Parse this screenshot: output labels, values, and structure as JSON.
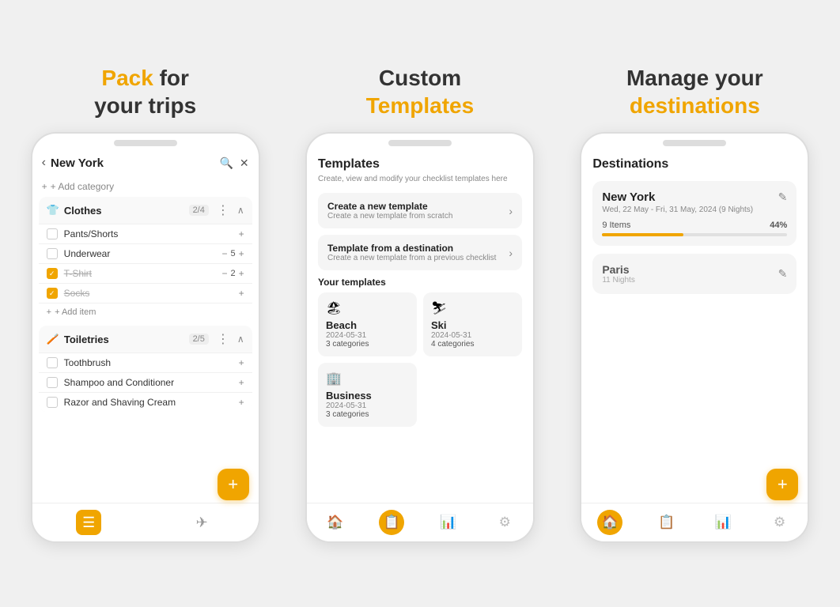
{
  "col1": {
    "headline_part1": "Pack ",
    "headline_part2": "for",
    "headline_part3": "your trips",
    "phone": {
      "title": "New York",
      "add_category": "+ Add category",
      "clothes": {
        "name": "Clothes",
        "count": "2/4",
        "items": [
          {
            "label": "Pants/Shorts",
            "checked": false,
            "qty": null
          },
          {
            "label": "Underwear",
            "checked": false,
            "qty": 5
          },
          {
            "label": "T-Shirt",
            "checked": true,
            "qty": 2
          },
          {
            "label": "Socks",
            "checked": true,
            "qty": null
          }
        ],
        "add_item": "+ Add item"
      },
      "toiletries": {
        "name": "Toiletries",
        "count": "2/5",
        "items": [
          {
            "label": "Toothbrush",
            "checked": false,
            "qty": null
          },
          {
            "label": "Shampoo and Conditioner",
            "checked": false,
            "qty": null
          },
          {
            "label": "Razor and Shaving Cream",
            "checked": false,
            "qty": null
          }
        ]
      },
      "fab_label": "+",
      "nav": [
        {
          "icon": "☰",
          "active": true
        },
        {
          "icon": "✈",
          "active": false
        }
      ]
    }
  },
  "col2": {
    "headline_part1": "Custom",
    "headline_part2": "Templates",
    "phone": {
      "title": "Templates",
      "subtitle": "Create, view and modify your checklist templates here",
      "actions": [
        {
          "title": "Create a new template",
          "sub": "Create a new template from scratch"
        },
        {
          "title": "Template from a destination",
          "sub": "Create a new template from a previous checklist"
        }
      ],
      "your_templates": "Your templates",
      "templates": [
        {
          "icon": "🏖",
          "name": "Beach",
          "date": "2024-05-31",
          "cats": "3 categories"
        },
        {
          "icon": "⛷",
          "name": "Ski",
          "date": "2024-05-31",
          "cats": "4 categories"
        },
        {
          "icon": "🏢",
          "name": "Business",
          "date": "2024-05-31",
          "cats": "3 categories"
        }
      ],
      "nav": [
        {
          "icon": "🏠",
          "active": false
        },
        {
          "icon": "📋",
          "active": true
        },
        {
          "icon": "📊",
          "active": false
        },
        {
          "icon": "⚙",
          "active": false
        }
      ]
    }
  },
  "col3": {
    "headline_part1": "Manage your",
    "headline_part2": "destinations",
    "phone": {
      "title": "Destinations",
      "destinations": [
        {
          "name": "New York",
          "dates": "Wed, 22 May - Fri, 31 May, 2024 (9 Nights)",
          "items_label": "9 Items",
          "pct": "44%",
          "pct_val": 44,
          "active": true
        },
        {
          "name": "Paris",
          "dates": "11 Nights",
          "active": false
        }
      ],
      "fab_label": "+",
      "nav": [
        {
          "icon": "🏠",
          "active": true
        },
        {
          "icon": "📋",
          "active": false
        },
        {
          "icon": "📊",
          "active": false
        },
        {
          "icon": "⚙",
          "active": false
        }
      ]
    }
  }
}
